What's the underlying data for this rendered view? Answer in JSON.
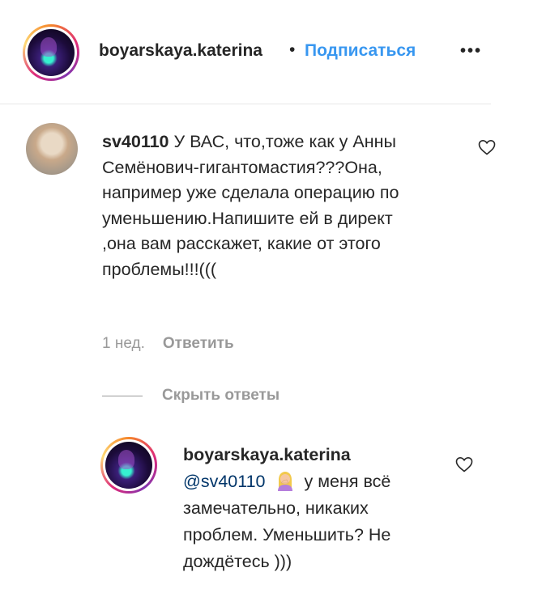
{
  "header": {
    "username": "boyarskaya.katerina",
    "separator": "•",
    "follow_label": "Подписаться",
    "more_glyph": "•••"
  },
  "comment": {
    "username": "sv40110",
    "text": "У ВАС, что,тоже как у Анны Семёнович-гигантомастия???Она, например уже сделала операцию по уменьшению.Напишите ей в директ ,она вам расскажет, какие от этого проблемы!!!(((",
    "time": "1 нед.",
    "reply_label": "Ответить"
  },
  "hide_replies_label": "Скрыть ответы",
  "reply": {
    "username": "boyarskaya.katerina",
    "mention": "@sv40110",
    "text": "у меня всё замечательно, никаких проблем. Уменьшить? Не дождётесь )))"
  },
  "icons": {
    "heart": "heart-outline-icon",
    "more": "more-options-icon",
    "emoji": "woman-facepalming-emoji"
  },
  "colors": {
    "text": "#262626",
    "link_blue": "#3897f0",
    "mention_blue": "#003569",
    "secondary_gray": "#999999"
  }
}
